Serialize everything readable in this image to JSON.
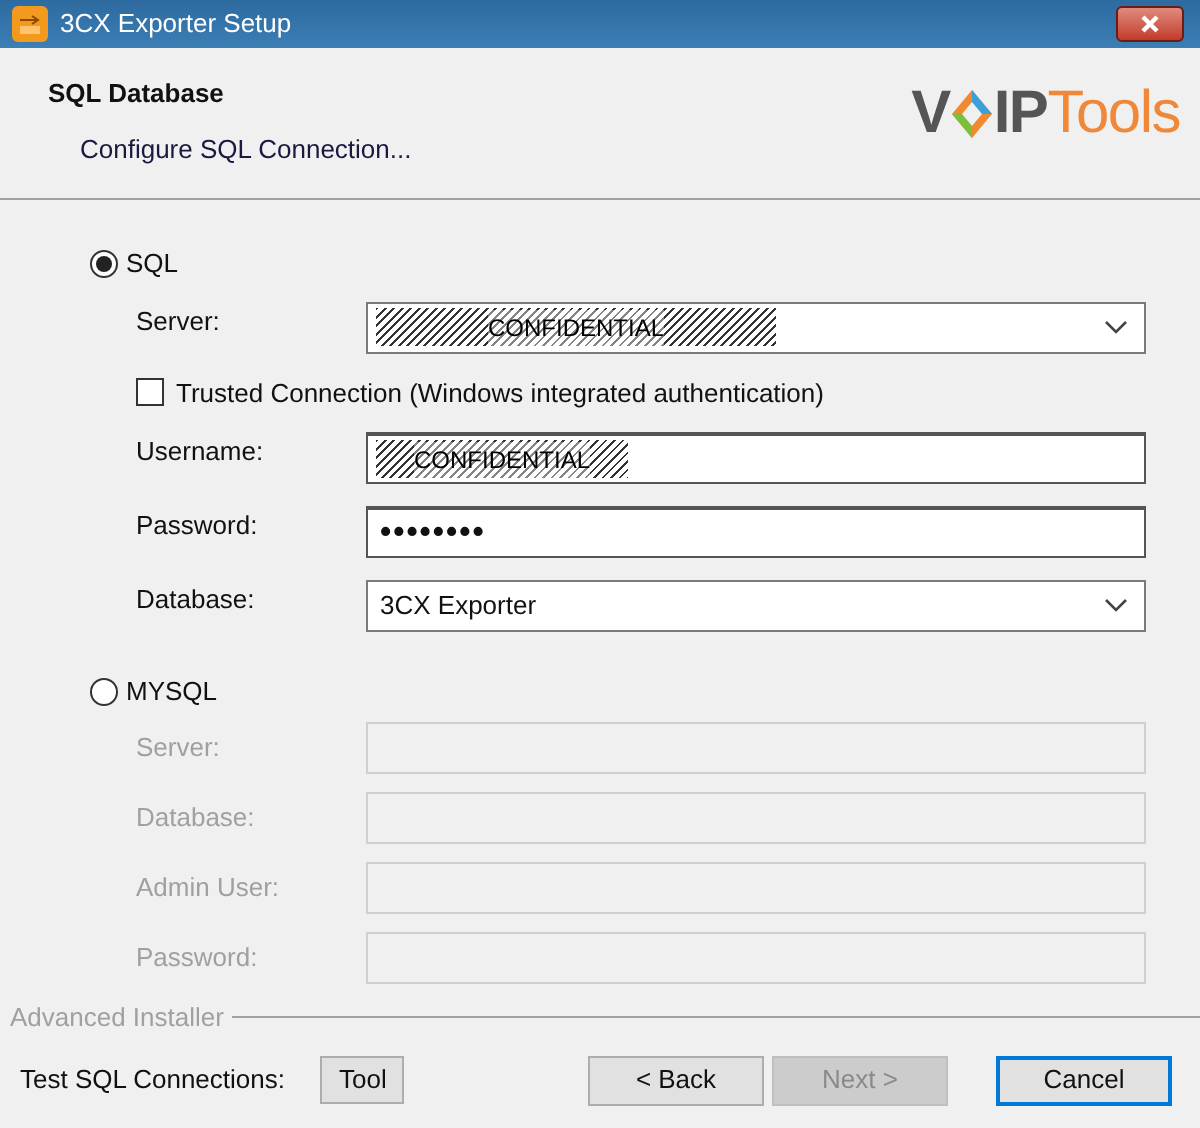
{
  "window": {
    "title": "3CX Exporter Setup"
  },
  "header": {
    "title": "SQL Database",
    "subtitle": "Configure SQL Connection...",
    "logo": {
      "prefix": "V",
      "middle": "IP",
      "suffix": "Tools"
    }
  },
  "sql": {
    "label": "SQL",
    "selected": true,
    "fields": [
      {
        "label": "Server:",
        "kind": "combo",
        "value": "CONFIDENTIAL",
        "redacted": true
      },
      {
        "kind": "checkbox",
        "label": "Trusted Connection (Windows integrated authentication)",
        "checked": false
      },
      {
        "label": "Username:",
        "kind": "text",
        "value": "CONFIDENTIAL",
        "redacted": true
      },
      {
        "label": "Password:",
        "kind": "password",
        "value": "••••••••",
        "redacted": false
      },
      {
        "label": "Database:",
        "kind": "combo",
        "value": "3CX Exporter",
        "redacted": false
      }
    ]
  },
  "mysql": {
    "label": "MYSQL",
    "selected": false,
    "disabled": true,
    "fields": [
      {
        "label": "Server:"
      },
      {
        "label": "Database:"
      },
      {
        "label": "Admin User:"
      },
      {
        "label": "Password:"
      }
    ]
  },
  "footer": {
    "brand": "Advanced Installer",
    "test_label": "Test SQL Connections:",
    "tool_button": "Tool",
    "buttons": [
      {
        "label": "< Back",
        "disabled": false,
        "default": false
      },
      {
        "label": "Next >",
        "disabled": true,
        "default": false
      },
      {
        "label": "Cancel",
        "disabled": false,
        "default": true
      }
    ]
  }
}
